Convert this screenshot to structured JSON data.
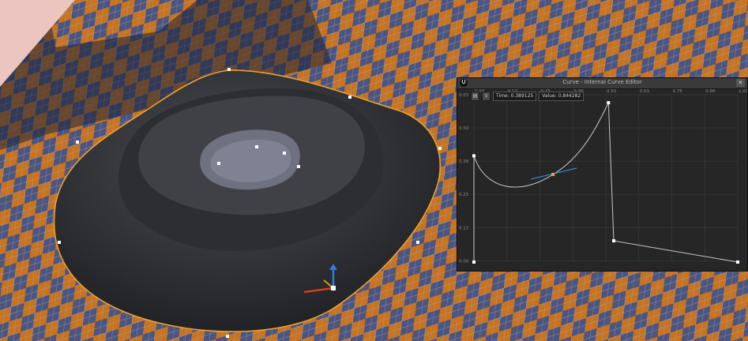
{
  "window": {
    "title": "Curve - Internal Curve Editor",
    "logo": "U",
    "close_label": "×"
  },
  "toolbar": {
    "icons": [
      "zoom-to-fit-icon",
      "keyframe-mode-icon"
    ],
    "time_label": "Time",
    "time_value": "0.389125",
    "value_label": "Value",
    "value_value": "0.844282"
  },
  "graph": {
    "x_ticks": [
      "0.00",
      "0.13",
      "0.25",
      "0.38",
      "0.50",
      "0.63",
      "0.75",
      "0.88",
      "1.00"
    ],
    "y_ticks": [
      "0.63",
      "0.50",
      "0.38",
      "0.25",
      "0.13",
      "0.00"
    ],
    "keys": [
      {
        "t": 0.0,
        "v": 0.0
      },
      {
        "t": 0.0,
        "v": 0.4
      },
      {
        "t": 0.51,
        "v": 0.6
      },
      {
        "t": 0.53,
        "v": 0.08
      },
      {
        "t": 1.0,
        "v": 0.0
      }
    ]
  },
  "colors": {
    "floor_orange": "#c8731f",
    "floor_blue": "#4b5580",
    "mesh": "#3a3b3f",
    "selection": "#f2a12a",
    "curve": "#c8c8c8",
    "tangent": "#2e8fd6"
  }
}
